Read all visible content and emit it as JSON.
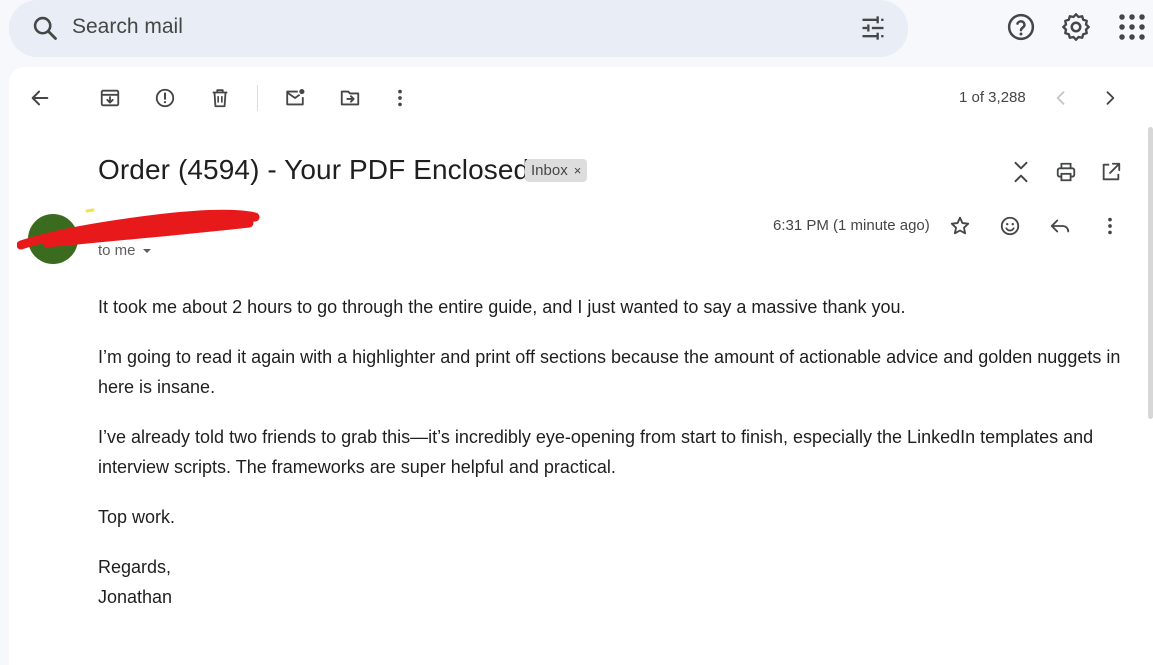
{
  "search": {
    "placeholder": "Search mail"
  },
  "toolbar": {
    "counter": "1 of 3,288"
  },
  "email": {
    "subject": "Order (4594) - Your PDF Enclosed",
    "label": "Inbox",
    "label_close": "×",
    "recipient": "to me",
    "timestamp": "6:31 PM (1 minute ago)",
    "paragraphs": [
      "It took me about 2 hours to go through the entire guide, and I just wanted to say a massive thank you.",
      "I’m going to read it again with a highlighter and print off sections because the amount of actionable advice and golden nuggets in here is insane.",
      "I’ve already told two friends to grab this—it’s incredibly eye-opening from start to finish, especially the LinkedIn templates and interview scripts. The frameworks are super helpful and practical.",
      "Top work.",
      "Regards,",
      "Jonathan"
    ]
  },
  "colors": {
    "avatar": "#3a6b1e",
    "redaction": "#e8191b",
    "search_bg": "#e9eef6",
    "page_bg": "#f6f8fc"
  },
  "icons": [
    "search-icon",
    "tune-icon",
    "help-icon",
    "settings-icon",
    "apps-icon",
    "back-arrow-icon",
    "archive-icon",
    "report-spam-icon",
    "delete-icon",
    "mark-unread-icon",
    "move-to-icon",
    "more-vert-icon",
    "prev-chevron-icon",
    "next-chevron-icon",
    "collapse-all-icon",
    "print-icon",
    "open-new-window-icon",
    "star-icon",
    "emoji-icon",
    "reply-icon",
    "more-vert-icon"
  ]
}
